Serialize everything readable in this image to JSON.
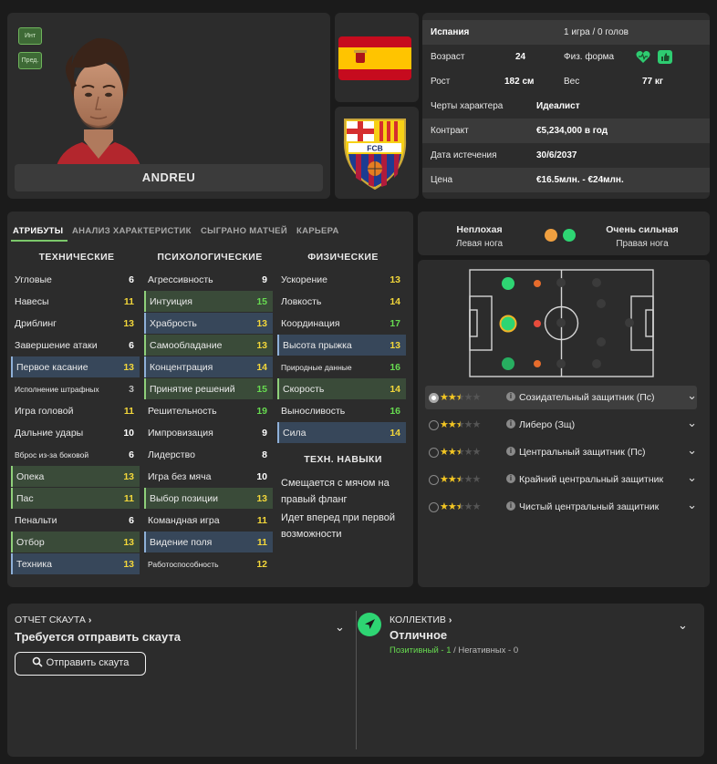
{
  "player": {
    "name": "ANDREU",
    "badges": [
      "Инт",
      "Пред."
    ]
  },
  "info": {
    "nation": "Испания",
    "caps": "1 игра / 0 голов",
    "age_label": "Возраст",
    "age": "24",
    "fitness_label": "Физ. форма",
    "height_label": "Рост",
    "height": "182 см",
    "weight_label": "Вес",
    "weight": "77 кг",
    "traits_label": "Черты характера",
    "traits": "Идеалист",
    "contract_label": "Контракт",
    "contract": "€5,234,000 в год",
    "expiry_label": "Дата истечения",
    "expiry": "30/6/2037",
    "price_label": "Цена",
    "price": "€16.5млн. - €24млн."
  },
  "club": {
    "crest_text": "FCB"
  },
  "tabs": [
    "АТРИБУТЫ",
    "АНАЛИЗ ХАРАКТЕРИСТИК",
    "СЫГРАНО МАТЧЕЙ",
    "КАРЬЕРА"
  ],
  "attributes": {
    "technical_title": "ТЕХНИЧЕСКИЕ",
    "mental_title": "ПСИХОЛОГИЧЕСКИЕ",
    "physical_title": "ФИЗИЧЕСКИЕ",
    "tech_skills_title": "ТЕХН. НАВЫКИ",
    "technical": [
      {
        "name": "Угловые",
        "value": "6"
      },
      {
        "name": "Навесы",
        "value": "11"
      },
      {
        "name": "Дриблинг",
        "value": "13"
      },
      {
        "name": "Завершение атаки",
        "value": "6"
      },
      {
        "name": "Первое касание",
        "value": "13"
      },
      {
        "name": "Исполнение штрафных",
        "value": "3"
      },
      {
        "name": "Игра головой",
        "value": "11"
      },
      {
        "name": "Дальние удары",
        "value": "10"
      },
      {
        "name": "Вброс из-за боковой",
        "value": "6"
      },
      {
        "name": "Опека",
        "value": "13"
      },
      {
        "name": "Пас",
        "value": "11"
      },
      {
        "name": "Пенальти",
        "value": "6"
      },
      {
        "name": "Отбор",
        "value": "13"
      },
      {
        "name": "Техника",
        "value": "13"
      }
    ],
    "mental": [
      {
        "name": "Агрессивность",
        "value": "9"
      },
      {
        "name": "Интуиция",
        "value": "15"
      },
      {
        "name": "Храбрость",
        "value": "13"
      },
      {
        "name": "Самообладание",
        "value": "13"
      },
      {
        "name": "Концентрация",
        "value": "14"
      },
      {
        "name": "Принятие решений",
        "value": "15"
      },
      {
        "name": "Решительность",
        "value": "19"
      },
      {
        "name": "Импровизация",
        "value": "9"
      },
      {
        "name": "Лидерство",
        "value": "8"
      },
      {
        "name": "Игра без мяча",
        "value": "10"
      },
      {
        "name": "Выбор позиции",
        "value": "13"
      },
      {
        "name": "Командная игра",
        "value": "11"
      },
      {
        "name": "Видение поля",
        "value": "11"
      },
      {
        "name": "Работоспособность",
        "value": "12"
      }
    ],
    "physical": [
      {
        "name": "Ускорение",
        "value": "13"
      },
      {
        "name": "Ловкость",
        "value": "14"
      },
      {
        "name": "Координация",
        "value": "17"
      },
      {
        "name": "Высота прыжка",
        "value": "13"
      },
      {
        "name": "Природные данные",
        "value": "16"
      },
      {
        "name": "Скорость",
        "value": "14"
      },
      {
        "name": "Выносливость",
        "value": "16"
      },
      {
        "name": "Сила",
        "value": "14"
      }
    ],
    "tech_skills": [
      "Смещается с мячом на правый фланг",
      "Идет вперед при первой возможности"
    ]
  },
  "feet": {
    "left_rating": "Неплохая",
    "left_label": "Левая нога",
    "right_rating": "Очень сильная",
    "right_label": "Правая нога",
    "left_color": "#f0a040",
    "right_color": "#2ed573"
  },
  "roles": [
    {
      "name": "Созидательный защитник (Пс)",
      "stars": 2.5
    },
    {
      "name": "Либеро (Зщ)",
      "stars": 2.5
    },
    {
      "name": "Центральный защитник (Пс)",
      "stars": 2.5
    },
    {
      "name": "Крайний центральный защитник",
      "stars": 2.5
    },
    {
      "name": "Чистый центральный защитник",
      "stars": 2.5
    }
  ],
  "scout": {
    "title": "ОТЧЕТ СКАУТА",
    "status": "Требуется отправить скаута",
    "button": "Отправить скаута"
  },
  "team": {
    "title": "КОЛЛЕКТИВ",
    "status": "Отличное",
    "positive": "Позитивный - 1",
    "separator": "/",
    "negative": "Негативных - 0"
  }
}
